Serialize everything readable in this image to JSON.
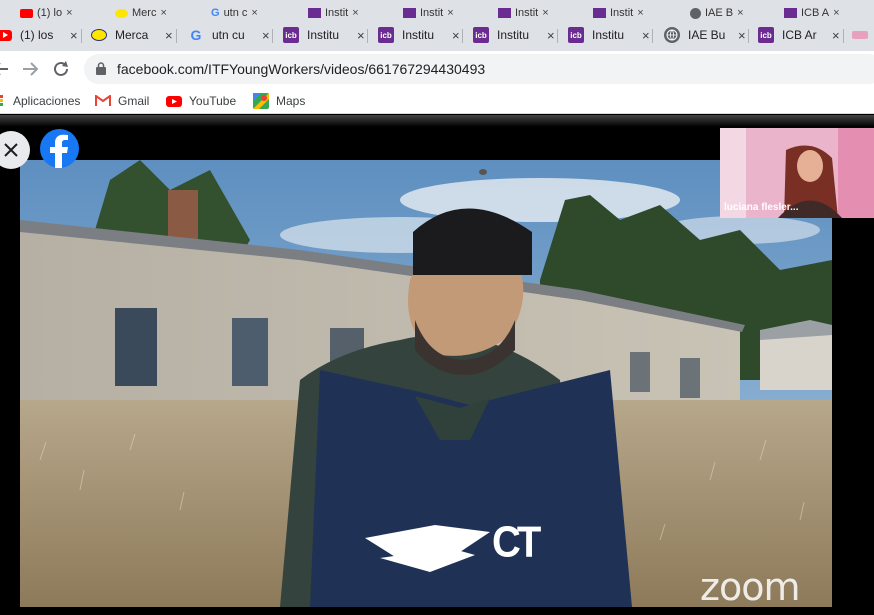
{
  "ghost_tabs": [
    {
      "label": "(1) lo",
      "icon": "youtube-icon"
    },
    {
      "label": "Merc",
      "icon": "mercado-icon"
    },
    {
      "label": "utn c",
      "icon": "google-icon"
    },
    {
      "label": "Instit",
      "icon": "icb-icon"
    },
    {
      "label": "Instit",
      "icon": "icb-icon"
    },
    {
      "label": "Instit",
      "icon": "icb-icon"
    },
    {
      "label": "Instit",
      "icon": "icb-icon"
    },
    {
      "label": "IAE B",
      "icon": "globe-icon"
    },
    {
      "label": "ICB A",
      "icon": "icb-icon"
    }
  ],
  "tabs": [
    {
      "label": "(1) los",
      "icon": "youtube-icon"
    },
    {
      "label": "Merca",
      "icon": "mercado-icon"
    },
    {
      "label": "utn cu",
      "icon": "google-icon"
    },
    {
      "label": "Institu",
      "icon": "icb-icon"
    },
    {
      "label": "Institu",
      "icon": "icb-icon"
    },
    {
      "label": "Institu",
      "icon": "icb-icon"
    },
    {
      "label": "Institu",
      "icon": "icb-icon"
    },
    {
      "label": "IAE Bu",
      "icon": "globe-icon"
    },
    {
      "label": "ICB Ar",
      "icon": "icb-icon"
    }
  ],
  "icon_text": {
    "icb": "icb",
    "google": "G"
  },
  "tab_close_glyph": "×",
  "toolbar": {
    "url": "facebook.com/ITFYoungWorkers/videos/661767294430493"
  },
  "bookmarks": [
    {
      "label": "Aplicaciones",
      "icon": "apps-grid-icon"
    },
    {
      "label": "Gmail",
      "icon": "gmail-icon"
    },
    {
      "label": "YouTube",
      "icon": "youtube-icon"
    },
    {
      "label": "Maps",
      "icon": "maps-icon"
    }
  ],
  "video": {
    "participant_name": "luciana flesler...",
    "watermark": "zoom",
    "vest_text": "CT"
  },
  "colors": {
    "facebook_blue": "#1877f2",
    "icb_purple": "#6b2c91",
    "youtube_red": "#ff0000",
    "chrome_tab_bg": "#dee1e6"
  }
}
